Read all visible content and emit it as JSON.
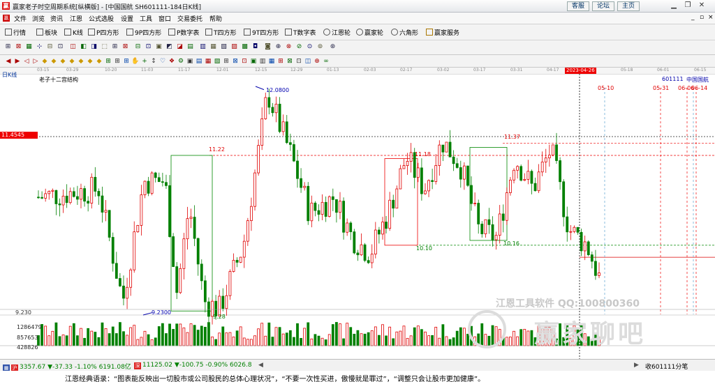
{
  "window": {
    "title": "赢家老子时空周期系统[纵横版] - [中国国航  SH601111-184日K线]",
    "buttons": [
      "客服",
      "论坛",
      "主页"
    ],
    "controls": [
      "minimize-icon",
      "restore-icon",
      "close-icon"
    ]
  },
  "menu": [
    "文件",
    "浏览",
    "资讯",
    "江恩",
    "公式选股",
    "设置",
    "工具",
    "窗口",
    "交易委托",
    "帮助"
  ],
  "toolbar": [
    {
      "label": "行情",
      "icon": "quote-icon"
    },
    {
      "label": "板块",
      "icon": "sector-icon"
    },
    {
      "label": "K线",
      "icon": "kline-icon"
    },
    {
      "label": "P四方形",
      "icon": "p-square-icon"
    },
    {
      "label": "9P四方形",
      "icon": "9p-square-icon"
    },
    {
      "label": "P数字表",
      "icon": "p-table-icon"
    },
    {
      "label": "T四方形",
      "icon": "t-square-icon"
    },
    {
      "label": "9T四方形",
      "icon": "9t-square-icon"
    },
    {
      "label": "T数字表",
      "icon": "t-table-icon"
    },
    {
      "label": "江恩轮",
      "icon": "gann-wheel-icon"
    },
    {
      "label": "赢家轮",
      "icon": "winner-wheel-icon"
    },
    {
      "label": "六角形",
      "icon": "hexagon-icon"
    },
    {
      "label": "赢家服务",
      "icon": "service-icon"
    }
  ],
  "date_axis": {
    "dates": [
      "03-15",
      "03-29",
      "10-20",
      "11-03",
      "11-17",
      "12-01",
      "12-15",
      "12-29",
      "01-13",
      "02-03",
      "02-17",
      "03-02",
      "03-17",
      "03-31",
      "04-17",
      "05-18",
      "06-01",
      "06-15"
    ],
    "selected": "2023-04-26"
  },
  "chart": {
    "period": "日K线",
    "name": "老子十二宫结构",
    "code": "601111",
    "stock_name": "中国国航",
    "current_price_label": "11.4545",
    "low_axis_label": "9.230",
    "volume_labels": [
      "1286479",
      "857653",
      "428826"
    ],
    "annotations": {
      "high": "12.0800",
      "low": "9.2300",
      "low2": "9.28",
      "level1": "11.22",
      "level2": "11.18",
      "level3": "11.37",
      "level4": "10.10",
      "level5": "10.16",
      "future_dates": [
        "05-10",
        "05-31",
        "06-06",
        "06-14"
      ]
    }
  },
  "watermark": {
    "line1": "江恩工具软件  QQ:100800360",
    "line2": "赢家聊吧"
  },
  "status": {
    "sh_index": "3357.67",
    "sh_change": "▼-37.33 -1.10% 6191.08亿",
    "sz_index": "11125.02",
    "sz_change": "▼-100.75 -0.90% 6026.8",
    "right": "收601111分笔"
  },
  "quote": "江恩经典语录：“图表能反映出一切股市或公司股民的总体心理状况”，“不要一次性买进，傲慢就是罪过”，“调整只会让股市更加健康”。",
  "colors": {
    "up": "#e00000",
    "down": "#008000",
    "accent": "#e00000"
  }
}
